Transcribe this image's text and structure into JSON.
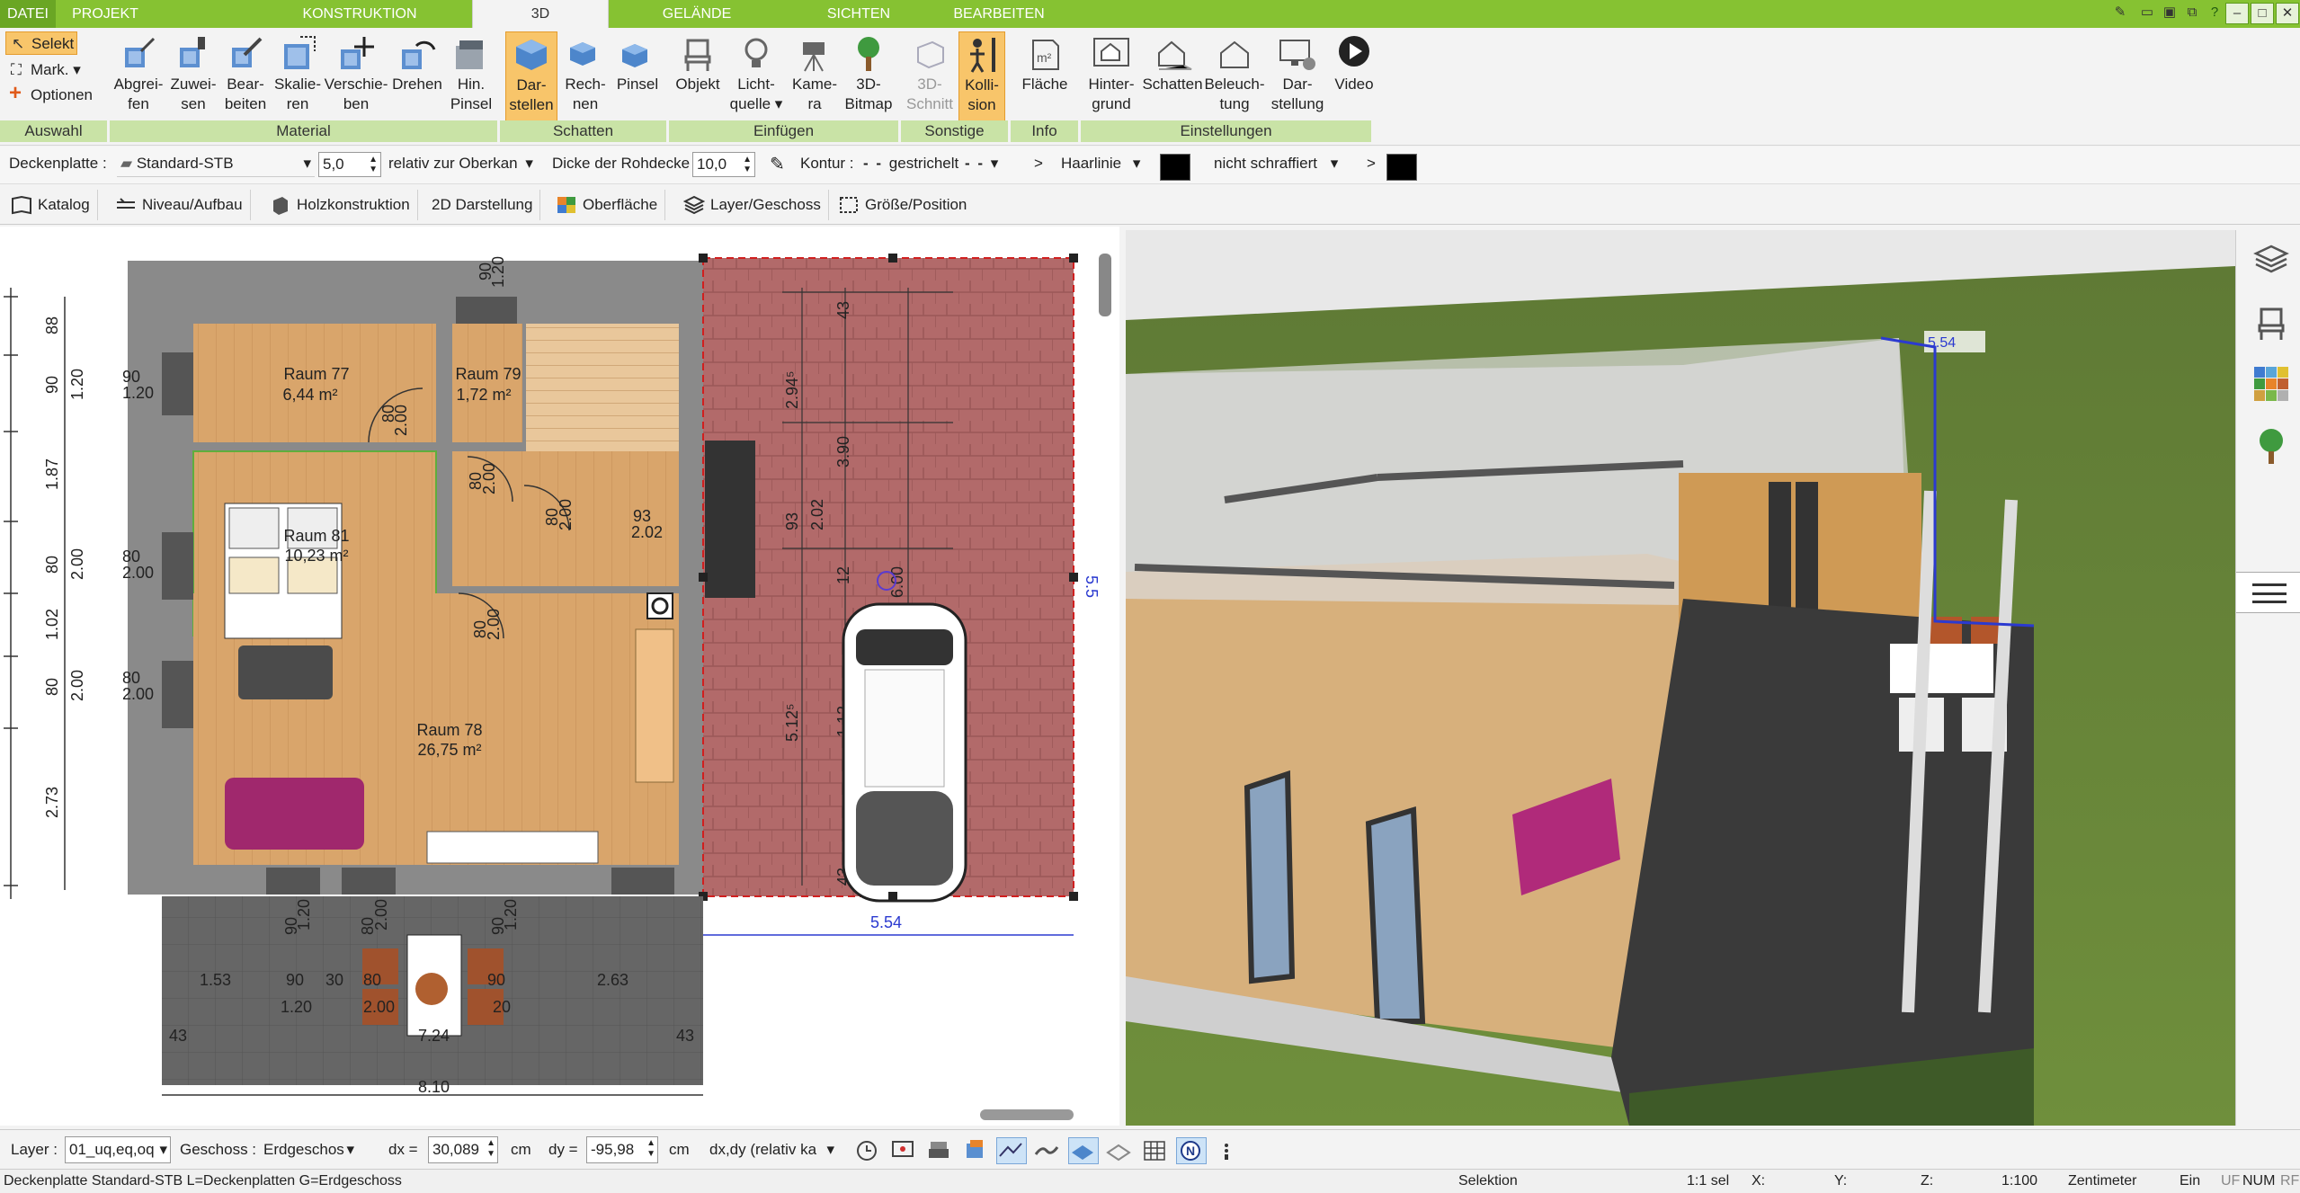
{
  "tabs": {
    "datei": "DATEI",
    "projekt": "PROJEKT",
    "konstruktion": "KONSTRUKTION",
    "3d": "3D",
    "gelaende": "GELÄNDE",
    "sichten": "SICHTEN",
    "bearbeiten": "BEARBEITEN"
  },
  "auswahl": {
    "selekt": "Selekt",
    "mark": "Mark.",
    "optionen": "Optionen",
    "group": "Auswahl"
  },
  "material": {
    "group": "Material",
    "b1": [
      "Abgrei-",
      "fen"
    ],
    "b2": [
      "Zuwei-",
      "sen"
    ],
    "b3": [
      "Bear-",
      "beiten"
    ],
    "b4": [
      "Skalie-",
      "ren"
    ],
    "b5": [
      "Verschie-",
      "ben"
    ],
    "b6": [
      "Drehen",
      ""
    ],
    "b7": [
      "Hin.",
      "Pinsel"
    ]
  },
  "schatten": {
    "group": "Schatten",
    "b1": [
      "Dar-",
      "stellen"
    ],
    "b2": [
      "Rech-",
      "nen"
    ],
    "b3": [
      "Pinsel",
      ""
    ]
  },
  "einfuegen": {
    "group": "Einfügen",
    "b1": [
      "Objekt",
      ""
    ],
    "b2": [
      "Licht-",
      "quelle"
    ],
    "b3": [
      "Kame-",
      "ra"
    ],
    "b4": [
      "3D-",
      "Bitmap"
    ]
  },
  "sonstige": {
    "group": "Sonstige",
    "b1": [
      "3D-",
      "Schnitt"
    ],
    "b2": [
      "Kolli-",
      "sion"
    ]
  },
  "info": {
    "group": "Info",
    "b1": [
      "Fläche",
      ""
    ]
  },
  "einstellungen": {
    "group": "Einstellungen",
    "b1": [
      "Hinter-",
      "grund"
    ],
    "b2": [
      "Schatten",
      ""
    ],
    "b3": [
      "Beleuch-",
      "tung"
    ],
    "b4": [
      "Dar-",
      "stellung"
    ],
    "b5": [
      "Video",
      ""
    ]
  },
  "props": {
    "deckenplatte_label": "Deckenplatte :",
    "material": "Standard-STB",
    "value1": "5,0",
    "relativ": "relativ zur Oberkan",
    "dicke_label": "Dicke der Rohdecke",
    "dicke": "10,0",
    "kontur_label": "Kontur :",
    "kontur_style": "gestrichelt",
    "arrow1": ">",
    "linie": "Haarlinie",
    "schraffur": "nicht schraffiert",
    "arrow2": ">"
  },
  "subtoolbar": [
    "Katalog",
    "Niveau/Aufbau",
    "Holzkonstruktion",
    "2D Darstellung",
    "Oberfläche",
    "Layer/Geschoss",
    "Größe/Position"
  ],
  "plan": {
    "rooms": [
      {
        "name": "Raum 77",
        "area": "6,44 m²"
      },
      {
        "name": "Raum 79",
        "area": "1,72 m²"
      },
      {
        "name": "Raum 81",
        "area": "10,23 m²"
      },
      {
        "name": "Raum 78",
        "area": "26,75 m²"
      }
    ],
    "dims": {
      "d_90_top": "90",
      "d_120_top": "1.20",
      "d_90_l1": "90",
      "d_120_l1": "1.20",
      "d_80a": "80",
      "d_200a": "2.00",
      "d_80b": "80",
      "d_200b": "2.00",
      "d_80c": "80",
      "d_200c": "2.00",
      "d_80d": "80",
      "d_200d": "2.00",
      "d_93": "93",
      "d_202": "2.02",
      "d_80l2": "80",
      "d_200l2": "2.00",
      "d_80l3": "80",
      "d_200l3": "2.00",
      "r_43": "43",
      "r_294": "2.94⁵",
      "r_390": "3.90",
      "r_93": "93",
      "r_202": "2.02",
      "r_12": "12",
      "r_512": "5.12⁵",
      "r_600": "6.00",
      "r_112": "1.12",
      "r_43b": "43",
      "r_554": "5.54",
      "b_90": "90",
      "b_120": "1.20",
      "b_80": "80",
      "b_200": "2.00",
      "b_90b": "90",
      "b_120b": "1.20",
      "b_153": "1.53",
      "b_90c": "90",
      "b_30": "30",
      "b_80b": "80",
      "b_90d": "90",
      "b_263": "2.63",
      "b_120c": "1.20",
      "b_200b": "2.00",
      "b_20": "20",
      "b_43": "43",
      "b_724": "7.24",
      "b_43b": "43",
      "b_810": "8.10",
      "l_88": "88",
      "l_90": "90",
      "l_120": "1.20",
      "l_187": "1.87",
      "l_80": "80",
      "l_200": "2.00",
      "l_102": "1.02",
      "l_80b": "80",
      "l_200b": "2.00",
      "l_273": "2.73"
    },
    "scene_dim": "5.54",
    "right_edge_label": "5.5"
  },
  "bottom": {
    "layer_label": "Layer :",
    "layer_value": "01_uq,eq,oq",
    "geschoss_label": "Geschoss :",
    "geschoss_value": "Erdgeschos",
    "dx_label": "dx =",
    "dx_value": "30,089",
    "dx_unit": "cm",
    "dy_label": "dy =",
    "dy_value": "-95,98",
    "dy_unit": "cm",
    "mode": "dx,dy (relativ ka"
  },
  "status": {
    "text": "Deckenplatte Standard-STB L=Deckenplatten G=Erdgeschoss",
    "selektion": "Selektion",
    "sel": "1:1 sel",
    "x": "X:",
    "y": "Y:",
    "z": "Z:",
    "scale": "1:100",
    "unit": "Zentimeter",
    "ein": "Ein",
    "uf": "UF",
    "num": "NUM",
    "rf": "RF"
  },
  "colors": {
    "accent": "#86c232",
    "selection": "#f8c56a",
    "slab": "#b46a6a"
  }
}
